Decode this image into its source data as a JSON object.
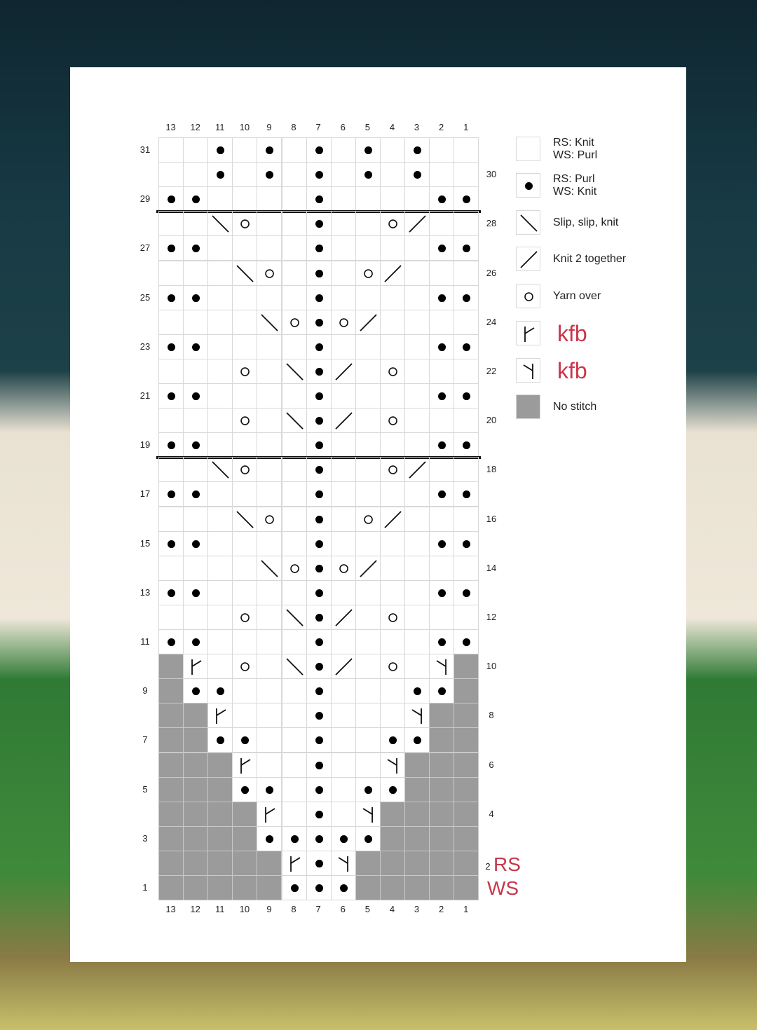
{
  "chart": {
    "column_numbers": [
      "13",
      "12",
      "11",
      "10",
      "9",
      "8",
      "7",
      "6",
      "5",
      "4",
      "3",
      "2",
      "1"
    ],
    "symbol_key": {
      "k": "knit",
      "p": "purl",
      "s": "ssk",
      "t": "k2tog",
      "o": "yo",
      "L": "kfb-left",
      "R": "kfb-right",
      "x": "no-stitch"
    },
    "rows": [
      {
        "n": "31",
        "side": "left",
        "st": "kkpkpkpkpkpkk"
      },
      {
        "n": "30",
        "side": "right",
        "st": "kkpkpkpkpkpkk"
      },
      {
        "n": "29",
        "side": "left",
        "st": "ppkkkkpkkkkpp"
      },
      {
        "n": "28",
        "side": "right",
        "st": "kksokkpkkotkk"
      },
      {
        "n": "27",
        "side": "left",
        "st": "ppkkkkpkkkkpp"
      },
      {
        "n": "26",
        "side": "right",
        "st": "kkksokpkotkkk"
      },
      {
        "n": "25",
        "side": "left",
        "st": "ppkkkkpkkkkpp"
      },
      {
        "n": "24",
        "side": "right",
        "st": "kkkksopotkkkk"
      },
      {
        "n": "23",
        "side": "left",
        "st": "ppkkkkpkkkkpp"
      },
      {
        "n": "22",
        "side": "right",
        "st": "kkkoksptkokkk"
      },
      {
        "n": "21",
        "side": "left",
        "st": "ppkkkkpkkkkpp"
      },
      {
        "n": "20",
        "side": "right",
        "st": "kkkoksptkokkk"
      },
      {
        "n": "19",
        "side": "left",
        "st": "ppkkkkpkkkkpp"
      },
      {
        "n": "18",
        "side": "right",
        "st": "kksokkpkkotkk"
      },
      {
        "n": "17",
        "side": "left",
        "st": "ppkkkkpkkkkpp"
      },
      {
        "n": "16",
        "side": "right",
        "st": "kkksokpkotkkk"
      },
      {
        "n": "15",
        "side": "left",
        "st": "ppkkkkpkkkkpp"
      },
      {
        "n": "14",
        "side": "right",
        "st": "kkkksopotkkkk"
      },
      {
        "n": "13",
        "side": "left",
        "st": "ppkkkkpkkkkpp"
      },
      {
        "n": "12",
        "side": "right",
        "st": "kkkoksptkokkk"
      },
      {
        "n": "11",
        "side": "left",
        "st": "ppkkkkpkkkkpp"
      },
      {
        "n": "10",
        "side": "right",
        "st": "xLkoksptkokRx"
      },
      {
        "n": "9",
        "side": "left",
        "st": "xppkkkpkkkppx"
      },
      {
        "n": "8",
        "side": "right",
        "st": "xxLkkkpkkkRxx"
      },
      {
        "n": "7",
        "side": "left",
        "st": "xxppkkpkkppxx"
      },
      {
        "n": "6",
        "side": "right",
        "st": "xxxLkkpkkRxxx"
      },
      {
        "n": "5",
        "side": "left",
        "st": "xxxppkpkppxxx"
      },
      {
        "n": "4",
        "side": "right",
        "st": "xxxxLkpkRxxxx"
      },
      {
        "n": "3",
        "side": "left",
        "st": "xxxxpppppxxxx"
      },
      {
        "n": "2",
        "side": "right",
        "st": "xxxxxLpRxxxxx"
      },
      {
        "n": "1",
        "side": "left",
        "st": "xxxxxpppxxxxx"
      }
    ],
    "thick_lines_after_rows": [
      "29",
      "19"
    ],
    "rs_label": "RS",
    "ws_label": "WS",
    "accent_color": "#c8374a",
    "no_stitch_color": "#9b9b9b"
  },
  "legend": [
    {
      "sym": "k",
      "lines": [
        "RS: Knit",
        "WS: Purl"
      ]
    },
    {
      "sym": "p",
      "lines": [
        "RS: Purl",
        "WS: Knit"
      ]
    },
    {
      "sym": "s",
      "lines": [
        "Slip, slip, knit"
      ]
    },
    {
      "sym": "t",
      "lines": [
        "Knit 2 together"
      ]
    },
    {
      "sym": "o",
      "lines": [
        "Yarn over"
      ]
    },
    {
      "sym": "L",
      "lines": [
        "kfb"
      ],
      "red": true
    },
    {
      "sym": "R",
      "lines": [
        "kfb"
      ],
      "red": true
    },
    {
      "sym": "x",
      "lines": [
        "No stitch"
      ]
    }
  ]
}
